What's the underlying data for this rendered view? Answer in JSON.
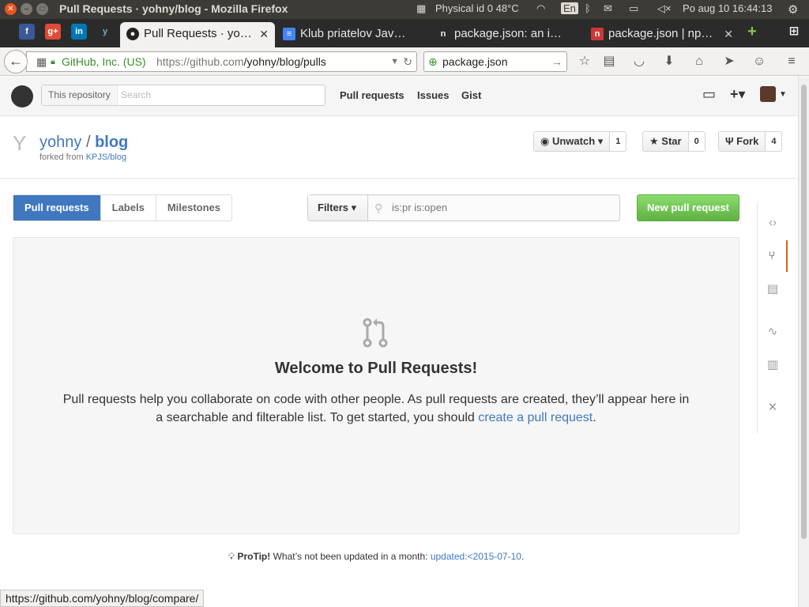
{
  "os": {
    "window_title": "Pull Requests · yohny/blog - Mozilla Firefox",
    "indicators": {
      "temp": "Physical id 0 48°C",
      "keyboard": "En",
      "datetime": "Po aug 10 16:44:13"
    }
  },
  "tabs": [
    {
      "label": "Pull Requests · yo…",
      "active": true,
      "icon": "github-icon"
    },
    {
      "label": "Klub priatelov Jav…",
      "active": false,
      "icon": "docs-icon"
    },
    {
      "label": "package.json: an i…",
      "active": false,
      "icon": "n-icon"
    },
    {
      "label": "package.json | np…",
      "active": false,
      "icon": "npm-icon"
    }
  ],
  "nav": {
    "site_identity": "GitHub, Inc. (US)",
    "url_prefix": "https://github.com",
    "url_path": "/yohny/blog/pulls",
    "search_value": "package.json"
  },
  "github": {
    "search_scope": "This repository",
    "search_placeholder": "Search",
    "nav": {
      "pull_requests": "Pull requests",
      "issues": "Issues",
      "gist": "Gist"
    }
  },
  "repo": {
    "owner": "yohny",
    "separator": "/",
    "name": "blog",
    "forked_prefix": "forked from",
    "forked_from": "KPJS/blog",
    "unwatch_label": "Unwatch",
    "watch_count": "1",
    "star_label": "Star",
    "star_count": "0",
    "fork_label": "Fork",
    "fork_count": "4"
  },
  "subnav": {
    "pull_requests": "Pull requests",
    "labels": "Labels",
    "milestones": "Milestones",
    "filters": "Filters",
    "filter_query": "is:pr is:open",
    "new_pr": "New pull request"
  },
  "blankslate": {
    "title": "Welcome to Pull Requests!",
    "text": "Pull requests help you collaborate on code with other people. As pull requests are created, they’ll appear here in a searchable and filterable list. To get started, you should ",
    "link": "create a pull request",
    "end": "."
  },
  "protip": {
    "label": "ProTip!",
    "text": " What’s not been updated in a month: ",
    "link": "updated:<2015-07-10",
    "end": "."
  },
  "statusbar": "https://github.com/yohny/blog/compare/"
}
